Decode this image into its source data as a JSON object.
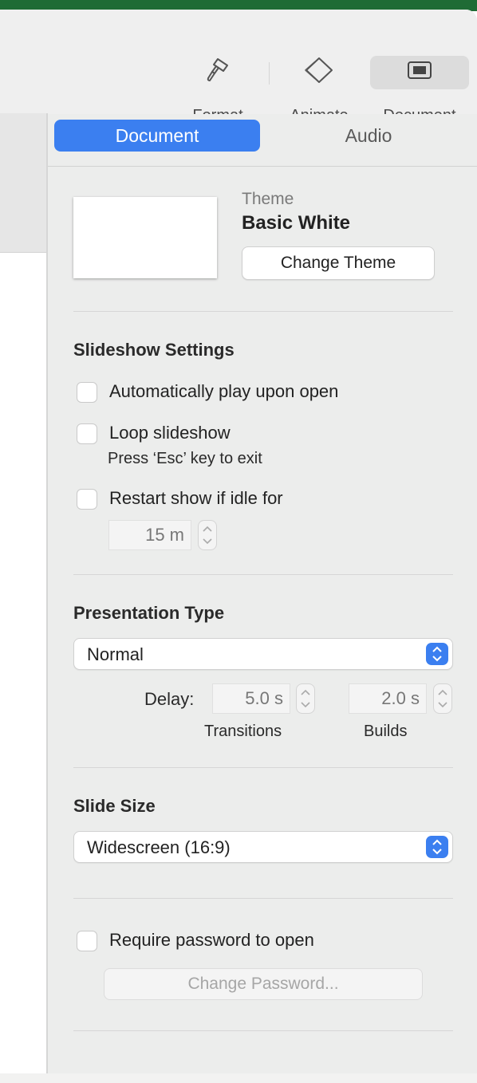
{
  "toolbar": {
    "format_label": "Format",
    "animate_label": "Animate",
    "document_label": "Document"
  },
  "tabs": {
    "document": "Document",
    "audio": "Audio"
  },
  "theme": {
    "label": "Theme",
    "name": "Basic White",
    "change_button": "Change Theme"
  },
  "slideshow": {
    "heading": "Slideshow Settings",
    "autoplay_label": "Automatically play upon open",
    "loop_label": "Loop slideshow",
    "loop_hint": "Press ‘Esc’ key to exit",
    "restart_label": "Restart show if idle for",
    "idle_value": "15 m"
  },
  "presentation": {
    "heading": "Presentation Type",
    "type_value": "Normal",
    "delay_label": "Delay:",
    "transitions_value": "5.0 s",
    "builds_value": "2.0 s",
    "transitions_label": "Transitions",
    "builds_label": "Builds"
  },
  "slide_size": {
    "heading": "Slide Size",
    "value": "Widescreen (16:9)"
  },
  "password": {
    "require_label": "Require password to open",
    "change_button": "Change Password..."
  },
  "colors": {
    "accent": "#3b7ff0",
    "titlebar_green": "#1f6b35"
  }
}
